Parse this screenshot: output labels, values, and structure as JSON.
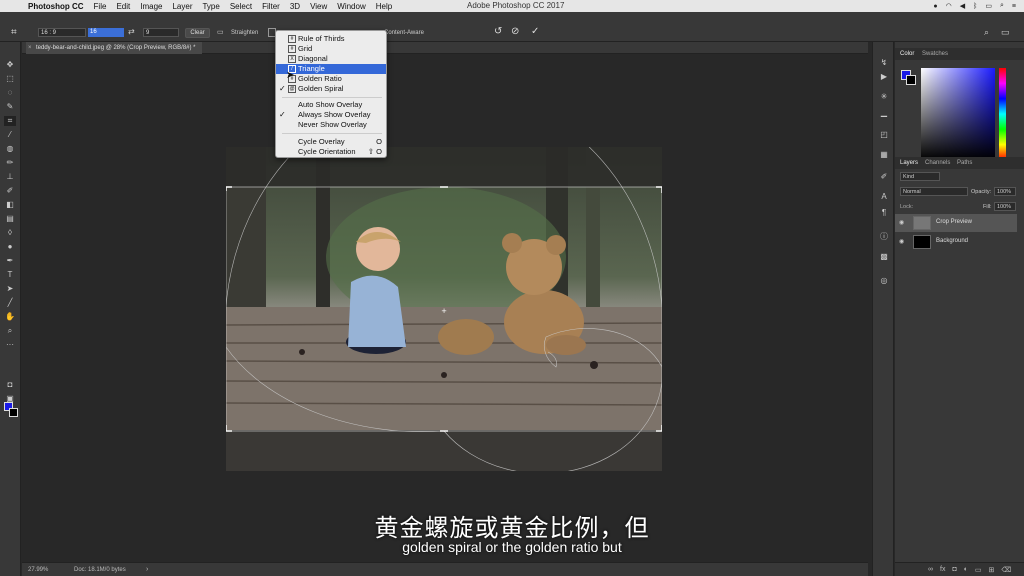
{
  "menubar": {
    "app": "Photoshop CC",
    "items": [
      "File",
      "Edit",
      "Image",
      "Layer",
      "Type",
      "Select",
      "Filter",
      "3D",
      "View",
      "Window",
      "Help"
    ],
    "window_title": "Adobe Photoshop CC 2017"
  },
  "options": {
    "ratio": "16 : 9",
    "value1": "16",
    "value2": "9",
    "clear": "Clear",
    "straighten": "Straighten",
    "content_aware": "Content-Aware"
  },
  "document": {
    "tab_title": "teddy-bear-and-child.jpeg @ 28% (Crop Preview, RGB/8#) *"
  },
  "overlay_menu": {
    "overlays": [
      {
        "label": "Rule of Thirds",
        "checked": false,
        "selected": false,
        "glyph": "#"
      },
      {
        "label": "Grid",
        "checked": false,
        "selected": false,
        "glyph": "#"
      },
      {
        "label": "Diagonal",
        "checked": false,
        "selected": false,
        "glyph": "X"
      },
      {
        "label": "Triangle",
        "checked": false,
        "selected": true,
        "glyph": "/"
      },
      {
        "label": "Golden Ratio",
        "checked": false,
        "selected": false,
        "glyph": "#"
      },
      {
        "label": "Golden Spiral",
        "checked": true,
        "selected": false,
        "glyph": "@"
      }
    ],
    "show_options": [
      {
        "label": "Auto Show Overlay",
        "checked": false
      },
      {
        "label": "Always Show Overlay",
        "checked": true
      },
      {
        "label": "Never Show Overlay",
        "checked": false
      }
    ],
    "cycle": [
      {
        "label": "Cycle Overlay",
        "shortcut": "O"
      },
      {
        "label": "Cycle Orientation",
        "shortcut": "⇧ O"
      }
    ]
  },
  "status": {
    "zoom": "27.99%",
    "doc": "Doc: 18.1M/0 bytes"
  },
  "panels": {
    "color_tabs": [
      "Color",
      "Swatches"
    ],
    "fg_color": "#1a1ae6",
    "bg_color": "#000000",
    "layer_tabs": [
      "Layers",
      "Channels",
      "Paths"
    ],
    "kind": "Kind",
    "blend_mode": "Normal",
    "opacity_label": "Opacity:",
    "opacity": "100%",
    "lock_label": "Lock:",
    "fill_label": "Fill:",
    "fill": "100%",
    "layers": [
      {
        "name": "Crop Preview"
      },
      {
        "name": "Background"
      }
    ]
  },
  "subtitles": {
    "zh": "黄金螺旋或黄金比例，但",
    "en": "golden spiral or the golden ratio but"
  }
}
